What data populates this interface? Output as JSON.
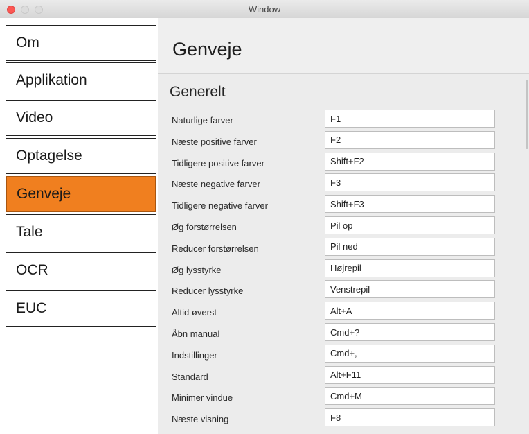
{
  "window": {
    "title": "Window"
  },
  "sidebar": {
    "items": [
      {
        "label": "Om"
      },
      {
        "label": "Applikation"
      },
      {
        "label": "Video"
      },
      {
        "label": "Optagelse"
      },
      {
        "label": "Genveje",
        "selected": true
      },
      {
        "label": "Tale"
      },
      {
        "label": "OCR"
      },
      {
        "label": "EUC"
      }
    ]
  },
  "colors": {
    "selected_bg": "#f07f1f",
    "selected_border": "#a95610"
  },
  "page": {
    "title": "Genveje"
  },
  "section": {
    "title": "Generelt",
    "shortcuts": [
      {
        "label": "Naturlige farver",
        "value": "F1"
      },
      {
        "label": "Næste positive farver",
        "value": "F2"
      },
      {
        "label": "Tidligere positive farver",
        "value": "Shift+F2"
      },
      {
        "label": "Næste negative farver",
        "value": "F3"
      },
      {
        "label": "Tidligere negative farver",
        "value": "Shift+F3"
      },
      {
        "label": "Øg forstørrelsen",
        "value": "Pil op"
      },
      {
        "label": "Reducer forstørrelsen",
        "value": "Pil ned"
      },
      {
        "label": "Øg lysstyrke",
        "value": "Højrepil"
      },
      {
        "label": "Reducer lysstyrke",
        "value": "Venstrepil"
      },
      {
        "label": "Altid øverst",
        "value": "Alt+A"
      },
      {
        "label": "Åbn manual",
        "value": "Cmd+?"
      },
      {
        "label": "Indstillinger",
        "value": "Cmd+,"
      },
      {
        "label": "Standard",
        "value": "Alt+F11"
      },
      {
        "label": "Minimer vindue",
        "value": "Cmd+M"
      },
      {
        "label": "Næste visning",
        "value": "F8"
      }
    ]
  }
}
